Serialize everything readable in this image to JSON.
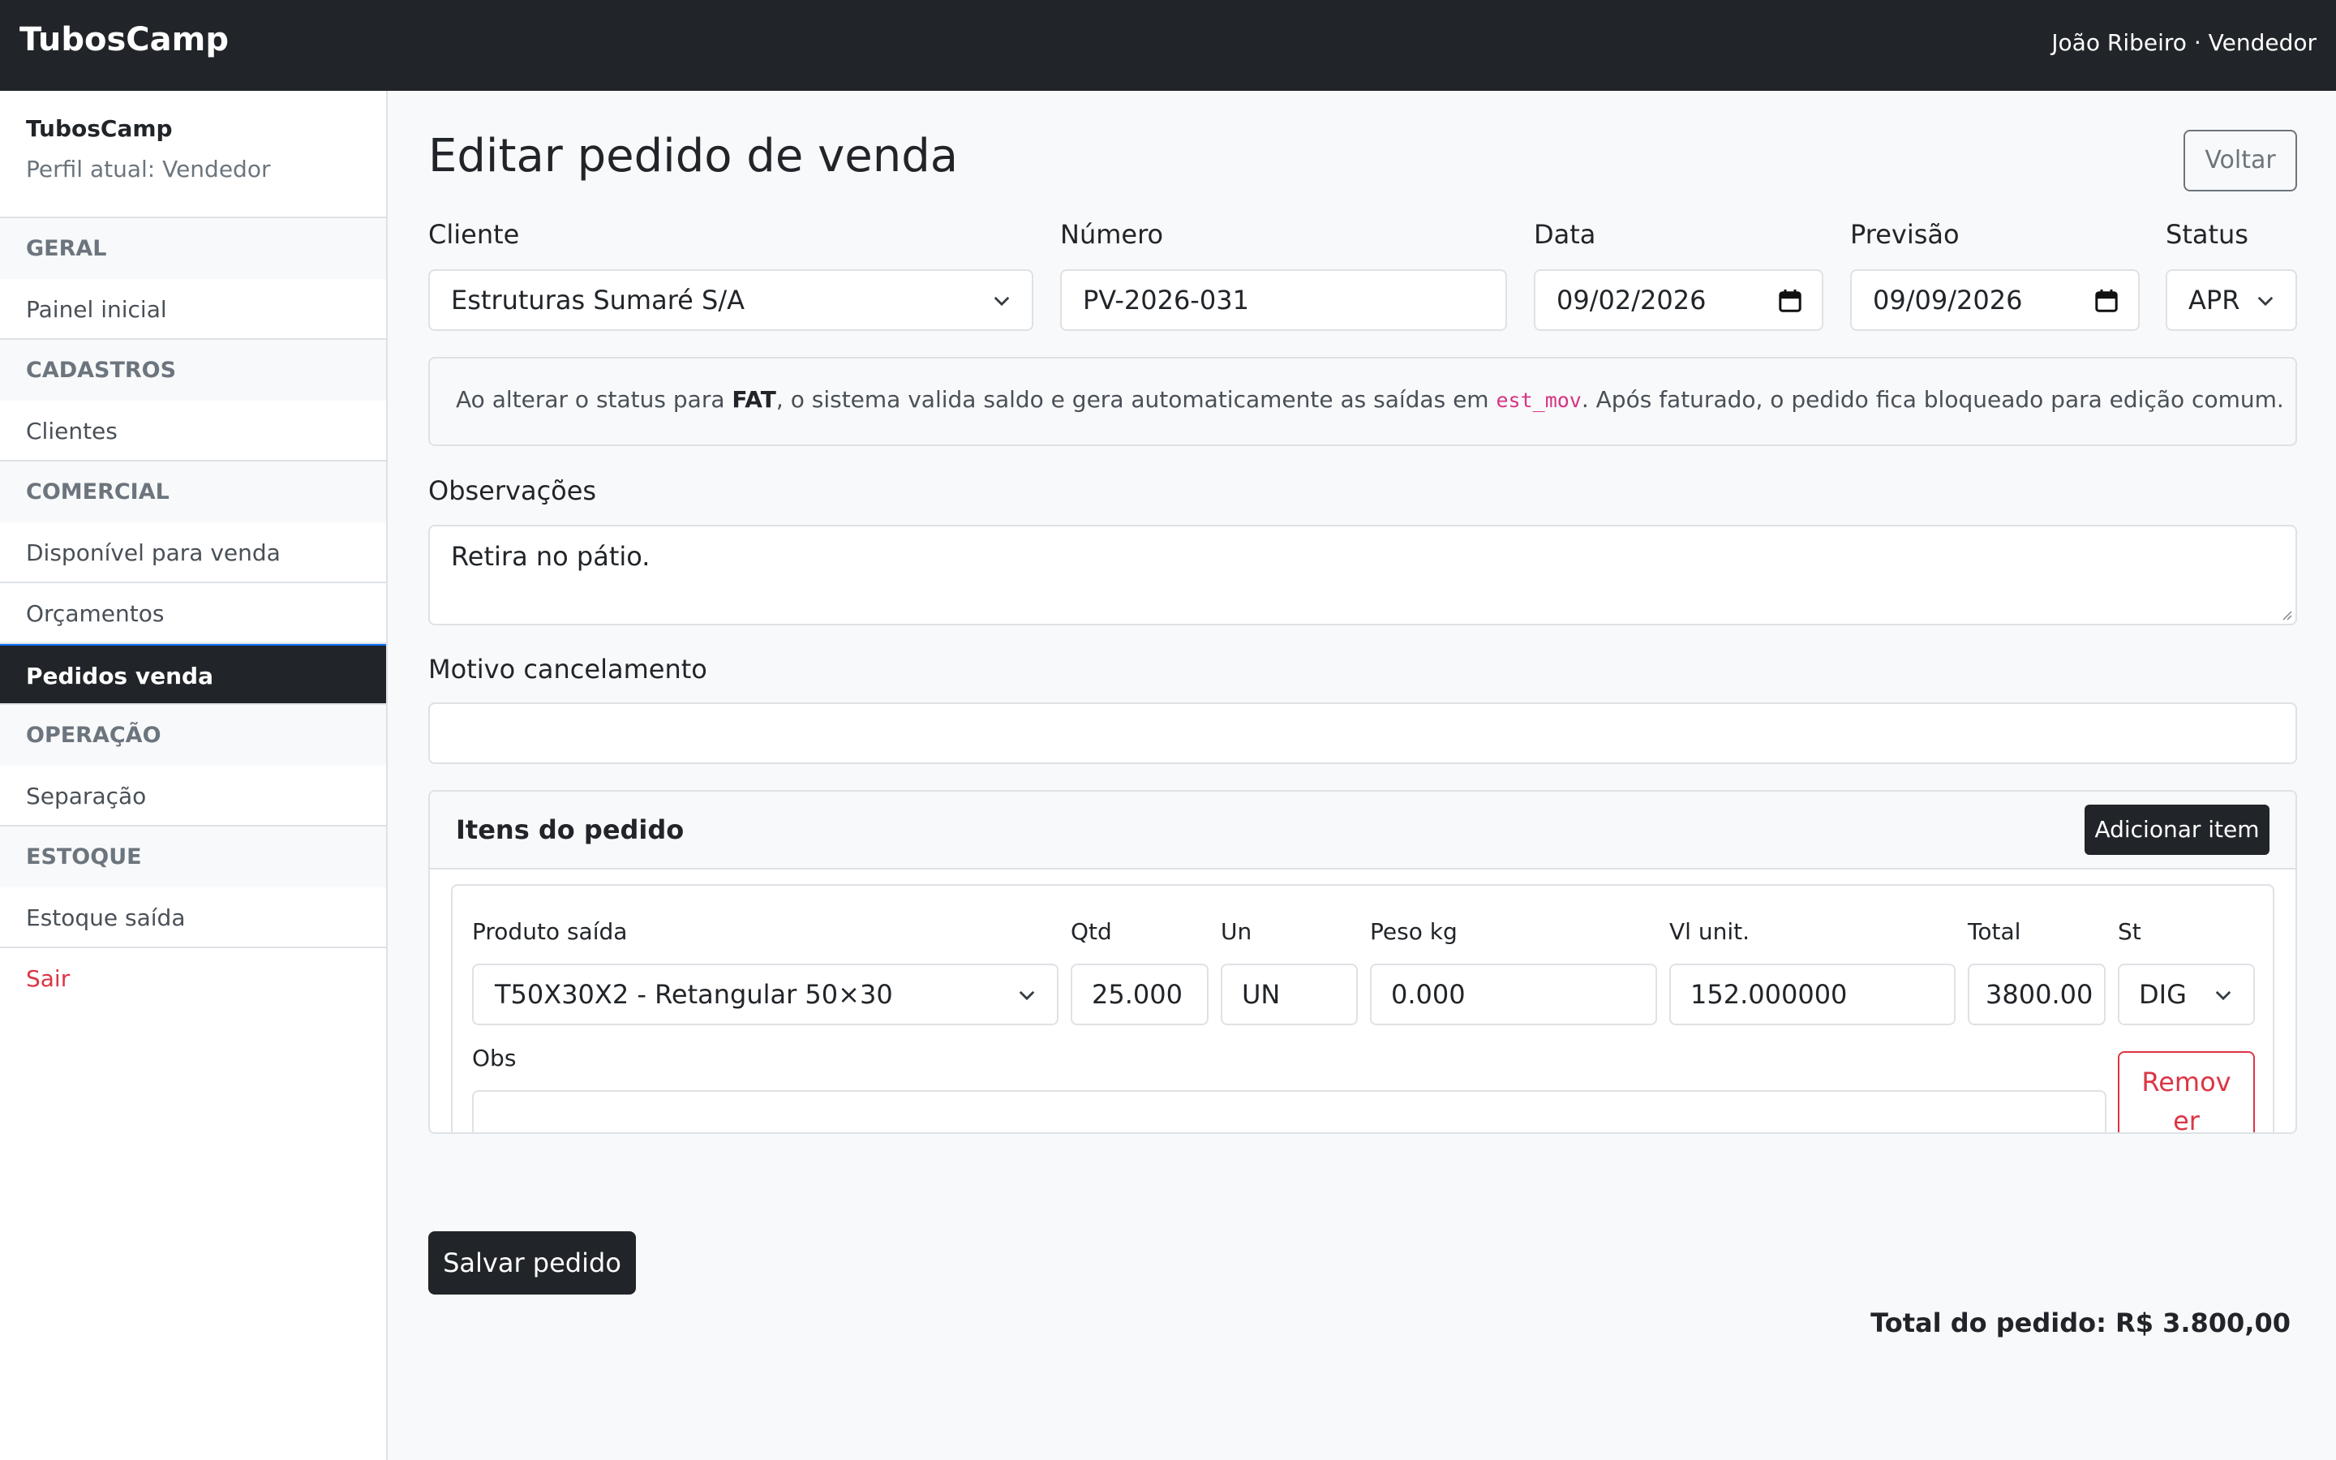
{
  "topbar": {
    "brand": "TubosCamp",
    "user": "João Ribeiro · Vendedor"
  },
  "sidebar": {
    "brand": "TubosCamp",
    "profile": "Perfil atual: Vendedor",
    "sections": {
      "geral": "GERAL",
      "cadastros": "CADASTROS",
      "comercial": "COMERCIAL",
      "operacao": "OPERAÇÃO",
      "estoque": "ESTOQUE"
    },
    "items": {
      "painel": "Painel inicial",
      "clientes": "Clientes",
      "disponivel": "Disponível para venda",
      "orcamentos": "Orçamentos",
      "pedidos": "Pedidos venda",
      "separacao": "Separação",
      "estoque_saida": "Estoque saída",
      "sair": "Sair"
    }
  },
  "page": {
    "title": "Editar pedido de venda",
    "back_label": "Voltar"
  },
  "form": {
    "cliente": {
      "label": "Cliente",
      "value": "Estruturas Sumaré S/A"
    },
    "numero": {
      "label": "Número",
      "value": "PV-2026-031"
    },
    "data": {
      "label": "Data",
      "value": "09/02/2026"
    },
    "previsao": {
      "label": "Previsão",
      "value": "09/09/2026"
    },
    "status": {
      "label": "Status",
      "value": "APR"
    },
    "observacoes": {
      "label": "Observações",
      "value": "Retira no pátio."
    },
    "motivo": {
      "label": "Motivo cancelamento",
      "value": ""
    }
  },
  "alert": {
    "prefix": "Ao alterar o status para ",
    "status": "FAT",
    "middle": ", o sistema valida saldo e gera automaticamente as saídas em ",
    "table": "est_mov",
    "suffix": ". Após faturado, o pedido fica bloqueado para edição comum."
  },
  "items": {
    "title": "Itens do pedido",
    "add_label": "Adicionar item",
    "headers": {
      "produto": "Produto saída",
      "qtd": "Qtd",
      "un": "Un",
      "peso": "Peso kg",
      "vl_unit": "Vl unit.",
      "total": "Total",
      "st": "St",
      "obs": "Obs"
    },
    "row": {
      "produto": "T50X30X2 - Retangular 50×30",
      "qtd": "25.000",
      "un": "UN",
      "peso": "0.000",
      "vl_unit": "152.000000",
      "total": "3800.00",
      "st": "DIG",
      "obs": "",
      "remove_line1": "Remov",
      "remove_line2": "er"
    }
  },
  "footer": {
    "save_label": "Salvar pedido",
    "total_label": "Total do pedido: R$ 3.800,00"
  },
  "icons": {
    "chevron": "chevron-down-icon",
    "calendar": "calendar-icon",
    "resize": "resize-grip-icon"
  },
  "colors": {
    "dark": "#212529",
    "danger": "#dc3545",
    "code": "#d63384",
    "muted": "#6c757d"
  }
}
